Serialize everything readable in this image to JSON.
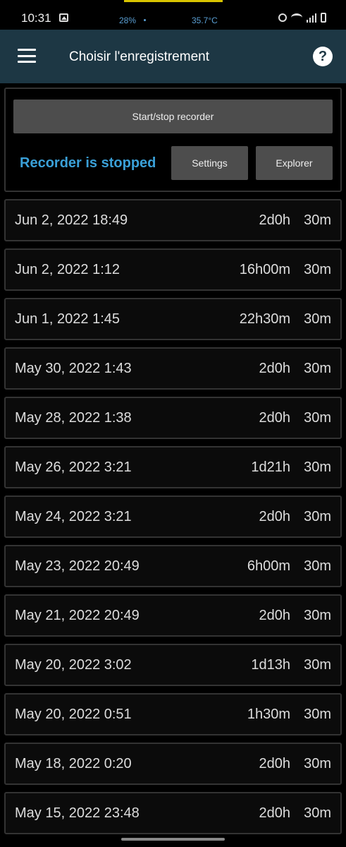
{
  "status_bar": {
    "time": "10:31",
    "cpu": "28%",
    "temperature": "35.7°C",
    "icons": [
      "image-icon",
      "alarm-icon",
      "wifi-icon",
      "signal-icon",
      "battery-icon"
    ]
  },
  "app_bar": {
    "title": "Choisir l'enregistrement",
    "help_label": "?",
    "background": "#1d3744"
  },
  "controls": {
    "start_stop_label": "Start/stop recorder",
    "status_text": "Recorder is stopped",
    "status_color": "#3aa0d8",
    "settings_label": "Settings",
    "explorer_label": "Explorer"
  },
  "recordings": [
    {
      "date": "Jun 2, 2022 18:49",
      "duration": "2d0h",
      "interval": "30m"
    },
    {
      "date": "Jun 2, 2022 1:12",
      "duration": "16h00m",
      "interval": "30m"
    },
    {
      "date": "Jun 1, 2022 1:45",
      "duration": "22h30m",
      "interval": "30m"
    },
    {
      "date": "May 30, 2022 1:43",
      "duration": "2d0h",
      "interval": "30m"
    },
    {
      "date": "May 28, 2022 1:38",
      "duration": "2d0h",
      "interval": "30m"
    },
    {
      "date": "May 26, 2022 3:21",
      "duration": "1d21h",
      "interval": "30m"
    },
    {
      "date": "May 24, 2022 3:21",
      "duration": "2d0h",
      "interval": "30m"
    },
    {
      "date": "May 23, 2022 20:49",
      "duration": "6h00m",
      "interval": "30m"
    },
    {
      "date": "May 21, 2022 20:49",
      "duration": "2d0h",
      "interval": "30m"
    },
    {
      "date": "May 20, 2022 3:02",
      "duration": "1d13h",
      "interval": "30m"
    },
    {
      "date": "May 20, 2022 0:51",
      "duration": "1h30m",
      "interval": "30m"
    },
    {
      "date": "May 18, 2022 0:20",
      "duration": "2d0h",
      "interval": "30m"
    },
    {
      "date": "May 15, 2022 23:48",
      "duration": "2d0h",
      "interval": "30m"
    }
  ]
}
